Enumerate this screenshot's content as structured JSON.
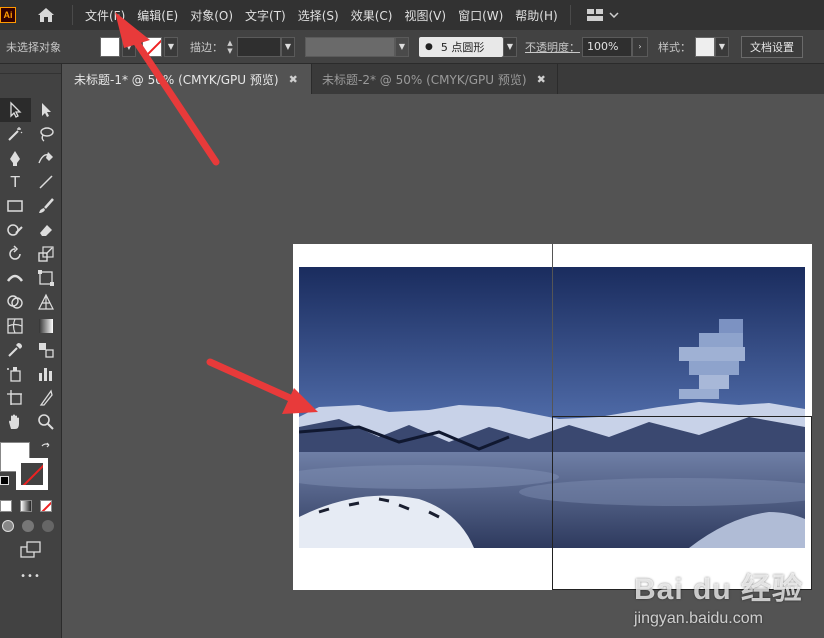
{
  "menubar": {
    "logo": "Ai",
    "items": [
      "文件(F)",
      "编辑(E)",
      "对象(O)",
      "文字(T)",
      "选择(S)",
      "效果(C)",
      "视图(V)",
      "窗口(W)",
      "帮助(H)"
    ]
  },
  "controlbar": {
    "status": "未选择对象",
    "stroke_label": "描边：",
    "brush_value": "5 点圆形",
    "opacity_label": "不透明度：",
    "opacity_value": "100%",
    "style_label": "样式：",
    "doc_setup": "文档设置"
  },
  "tabs": [
    {
      "label": "未标题-1* @ 50% (CMYK/GPU 预览)",
      "close": "✖",
      "active": true
    },
    {
      "label": "未标题-2* @ 50% (CMYK/GPU 预览)",
      "close": "✖",
      "active": false
    }
  ],
  "toolbar": {
    "more": "•••"
  },
  "watermark": {
    "logo": "Bai du 经验",
    "url": "jingyan.baidu.com"
  },
  "colors": {
    "menubar_bg": "#323232",
    "panel_bg": "#424242",
    "canvas_bg": "#535353",
    "annotation_red": "#e83a3a",
    "ai_brand": "#ff9a00"
  }
}
